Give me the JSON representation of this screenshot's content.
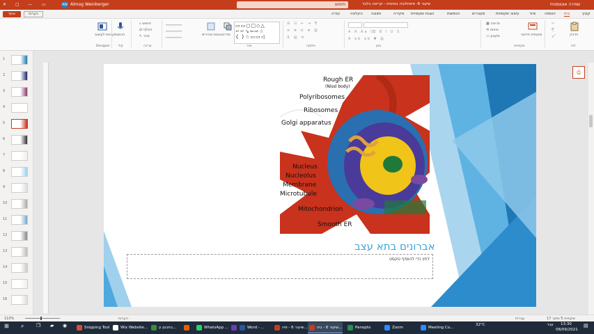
{
  "titlebar": {
    "autosave": "שמירה אוטומטית",
    "doc_title": "שיעור 6- פיסיולוגיה בסיסית - קריאה בלבד",
    "search": "חיפוש",
    "user": "Almog Weinberger",
    "avatar": "AW"
  },
  "tabs": [
    {
      "label": "קובץ"
    },
    {
      "label": "בית",
      "active": true
    },
    {
      "label": "הוספה"
    },
    {
      "label": "ציור"
    },
    {
      "label": "עיצוב שקופיות"
    },
    {
      "label": "מעברים"
    },
    {
      "label": "הנפשות"
    },
    {
      "label": "הצגת שקופיות"
    },
    {
      "label": "סקירה"
    },
    {
      "label": "תצוגה"
    },
    {
      "label": "הקלטה"
    },
    {
      "label": "עזרה"
    }
  ],
  "share_button": "שתף",
  "comments_button": "הערות",
  "ribbon": {
    "groups": [
      "לוח",
      "שקופיות",
      "גופן",
      "פיסקה",
      "ציור",
      "עריכה",
      "קול",
      "Designer"
    ],
    "buttons": {
      "paste": "הדבק",
      "new_slide": "שקופית חדשה",
      "layout": "פריסה",
      "reset": "איפוס",
      "section": "מקטע",
      "find": "חיפוש",
      "replace": "החלף",
      "select": "בחר",
      "dictate": "הכתבה",
      "design_ideas": "רעיונות לעיצוב",
      "arrange": "סדר",
      "quick_styles": "סגנונות מהירים"
    }
  },
  "slides": [
    {
      "num": "1"
    },
    {
      "num": "2"
    },
    {
      "num": "3"
    },
    {
      "num": "4"
    },
    {
      "num": "5",
      "selected": true
    },
    {
      "num": "6"
    },
    {
      "num": "7"
    },
    {
      "num": "8"
    },
    {
      "num": "9"
    },
    {
      "num": "10"
    },
    {
      "num": "11"
    },
    {
      "num": "12"
    },
    {
      "num": "13"
    },
    {
      "num": "14"
    },
    {
      "num": "15"
    },
    {
      "num": "16"
    }
  ],
  "slide": {
    "title": "אברונים בתא עצב",
    "text_placeholder": "לחץ כדי להוסיף טקסט",
    "cell_labels": {
      "rough_er": "Rough ER",
      "nissl": "(Nissl body)",
      "polyribosomes": "Polyribosomes",
      "ribosomes": "Ribosomes",
      "golgi": "Golgi apparatus",
      "nucleus": "Nucleus",
      "nucleolus": "Nucleolus",
      "membrane": "Membrane",
      "microtubule": "Microtubule",
      "mitochondrion": "Mitochondrion",
      "smooth_er": "Smooth ER"
    }
  },
  "statusbar": {
    "slide_info": "שקופית 5 מתוך 17",
    "zoom": "110%",
    "notes": "הערות",
    "lang": "עברית"
  },
  "taskbar": {
    "apps": [
      {
        "label": "Snipping Tool",
        "color": "#d94b3a"
      },
      {
        "label": "Wix Website...",
        "color": "#ffffff"
      },
      {
        "label": "בתכנון ע...",
        "color": "#3c8b3c"
      },
      {
        "label": "",
        "color": "#e66000"
      },
      {
        "label": "WhatsApp ...",
        "color": "#25d366"
      },
      {
        "label": "",
        "color": "#6a3fb5"
      },
      {
        "label": "Word - ...",
        "color": "#2b579a"
      },
      {
        "label": "שיעור 6 - פיוו...",
        "color": "#c43e1c"
      },
      {
        "label": "שיעור 6 - ביוו...",
        "color": "#c43e1c",
        "active": true
      },
      {
        "label": "Panopto",
        "color": "#2e8b57"
      },
      {
        "label": "Zoom",
        "color": "#2d8cff"
      },
      {
        "label": "Meeting Co...",
        "color": "#2d8cff"
      }
    ],
    "weather": "32°C",
    "time": "13:30",
    "date": "08/09/2021",
    "lang": "עבר"
  }
}
